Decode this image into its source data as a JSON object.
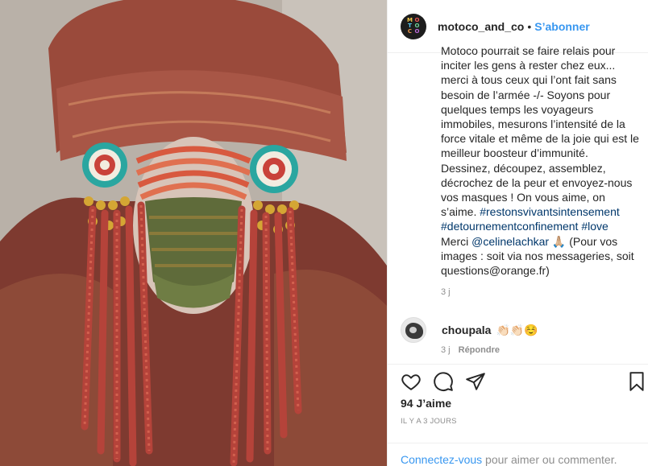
{
  "post": {
    "image_alt": "Masque de perles rouges et turban à motifs"
  },
  "header": {
    "username": "motoco_and_co",
    "separator": "•",
    "follow_label": "S’abonner",
    "avatar_letters": [
      "M",
      "O",
      "T",
      "O",
      "C",
      "O"
    ],
    "avatar_colors": [
      "#f2c94c",
      "#eb5757",
      "#56ccf2",
      "#6fcf97",
      "#f2994a",
      "#bb6bd9"
    ]
  },
  "caption": {
    "cut_line": "Motoco pourrait se faire relais pour",
    "text_before_tags": "inciter les gens à rester chez eux... merci à tous ceux qui l’ont fait sans besoin de l’armée -/- Soyons pour quelques temps les voyageurs immobiles, mesurons l’intensité de la force vitale et même de la joie qui est le meilleur boosteur d’immunité. Dessinez, découpez, assemblez, décrochez de la peur et envoyez-nous vos masques ! On vous aime, on s’aime. ",
    "hashtag1": "#restonsvivantsintensement",
    "hashtag2": "#detournementconfinement",
    "hashtag3": "#love",
    "merci": "Merci ",
    "mention": "@celinelachkar",
    "text_after_mention": " 🙏🏼 (Pour vos images : soit via nos messageries, soit questions@orange.fr)",
    "time": "3 j"
  },
  "comment": {
    "username": "choupala",
    "text": "👏🏻👏🏻☺️",
    "time": "3 j",
    "reply_label": "Répondre"
  },
  "actions": {
    "like_icon": "heart-icon",
    "comment_icon": "speech-bubble-icon",
    "share_icon": "paper-plane-icon",
    "save_icon": "bookmark-icon"
  },
  "likes": "94 J’aime",
  "date": "IL Y A 3 JOURS",
  "add_comment": {
    "login_link": "Connectez-vous",
    "rest": " pour aimer ou commenter."
  }
}
